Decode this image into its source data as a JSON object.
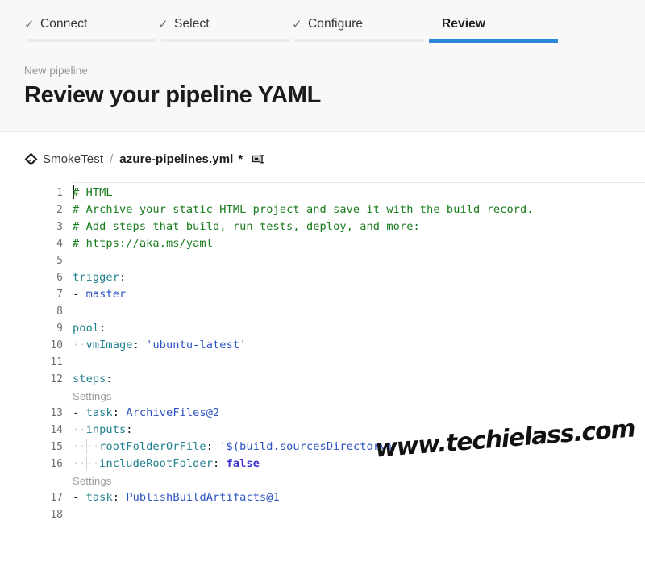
{
  "wizard": {
    "tabs": [
      {
        "label": "Connect",
        "check": "✓",
        "state": "complete"
      },
      {
        "label": "Select",
        "check": "✓",
        "state": "complete"
      },
      {
        "label": "Configure",
        "check": "✓",
        "state": "complete"
      },
      {
        "label": "Review",
        "check": "",
        "state": "active"
      }
    ],
    "active_accent": "#2b88d8",
    "rail_color": "#ebebeb"
  },
  "header": {
    "eyebrow": "New pipeline",
    "title": "Review your pipeline YAML"
  },
  "file_bar": {
    "repo_icon": "azure-repos-git-icon",
    "repo": "SmokeTest",
    "separator": "/",
    "file": "azure-pipelines.yml",
    "dirty_marker": "*",
    "rename_icon": "rename-icon"
  },
  "editor": {
    "language": "yaml",
    "codelens_label": "Settings",
    "lines": [
      {
        "num": "1",
        "type": "code",
        "indent": 0,
        "segments": [
          {
            "t": "# HTML",
            "c": "tok-comment"
          }
        ]
      },
      {
        "num": "2",
        "type": "code",
        "indent": 0,
        "segments": [
          {
            "t": "# Archive your static HTML project and save it with the build record.",
            "c": "tok-comment"
          }
        ]
      },
      {
        "num": "3",
        "type": "code",
        "indent": 0,
        "segments": [
          {
            "t": "# Add steps that build, run tests, deploy, and more:",
            "c": "tok-comment"
          }
        ]
      },
      {
        "num": "4",
        "type": "code",
        "indent": 0,
        "segments": [
          {
            "t": "# ",
            "c": "tok-comment"
          },
          {
            "t": "https://aka.ms/yaml",
            "c": "tok-link"
          }
        ]
      },
      {
        "num": "5",
        "type": "code",
        "indent": 0,
        "segments": []
      },
      {
        "num": "6",
        "type": "code",
        "indent": 0,
        "segments": [
          {
            "t": "trigger",
            "c": "tok-key"
          },
          {
            "t": ":",
            "c": "tok-punct"
          }
        ]
      },
      {
        "num": "7",
        "type": "code",
        "indent": 0,
        "segments": [
          {
            "t": "-",
            "c": "tok-dash"
          },
          {
            "t": " ",
            "c": "ws"
          },
          {
            "t": "master",
            "c": "tok-val"
          }
        ]
      },
      {
        "num": "8",
        "type": "code",
        "indent": 0,
        "segments": []
      },
      {
        "num": "9",
        "type": "code",
        "indent": 0,
        "segments": [
          {
            "t": "pool",
            "c": "tok-key"
          },
          {
            "t": ":",
            "c": "tok-punct"
          }
        ]
      },
      {
        "num": "10",
        "type": "code",
        "indent": 1,
        "segments": [
          {
            "t": "vmImage",
            "c": "tok-key"
          },
          {
            "t": ":",
            "c": "tok-punct"
          },
          {
            "t": " ",
            "c": "ws"
          },
          {
            "t": "'ubuntu-latest'",
            "c": "tok-string"
          }
        ]
      },
      {
        "num": "11",
        "type": "code",
        "indent": 0,
        "segments": []
      },
      {
        "num": "12",
        "type": "code",
        "indent": 0,
        "segments": [
          {
            "t": "steps",
            "c": "tok-key"
          },
          {
            "t": ":",
            "c": "tok-punct"
          }
        ]
      },
      {
        "num": "",
        "type": "codelens",
        "indent": 0,
        "segments": [
          {
            "t": "Settings",
            "c": ""
          }
        ]
      },
      {
        "num": "13",
        "type": "code",
        "indent": 0,
        "segments": [
          {
            "t": "-",
            "c": "tok-dash"
          },
          {
            "t": " ",
            "c": "ws"
          },
          {
            "t": "task",
            "c": "tok-key"
          },
          {
            "t": ":",
            "c": "tok-punct"
          },
          {
            "t": " ",
            "c": "ws"
          },
          {
            "t": "ArchiveFiles@2",
            "c": "tok-val"
          }
        ]
      },
      {
        "num": "14",
        "type": "code",
        "indent": 1,
        "segments": [
          {
            "t": "inputs",
            "c": "tok-key"
          },
          {
            "t": ":",
            "c": "tok-punct"
          }
        ]
      },
      {
        "num": "15",
        "type": "code",
        "indent": 2,
        "segments": [
          {
            "t": "rootFolderOrFile",
            "c": "tok-key"
          },
          {
            "t": ":",
            "c": "tok-punct"
          },
          {
            "t": " ",
            "c": "ws"
          },
          {
            "t": "'$(build.sourcesDirectory)'",
            "c": "tok-string"
          }
        ]
      },
      {
        "num": "16",
        "type": "code",
        "indent": 2,
        "segments": [
          {
            "t": "includeRootFolder",
            "c": "tok-key"
          },
          {
            "t": ":",
            "c": "tok-punct"
          },
          {
            "t": " ",
            "c": "ws"
          },
          {
            "t": "false",
            "c": "tok-bool"
          }
        ]
      },
      {
        "num": "",
        "type": "codelens",
        "indent": 0,
        "segments": [
          {
            "t": "Settings",
            "c": ""
          }
        ]
      },
      {
        "num": "17",
        "type": "code",
        "indent": 0,
        "segments": [
          {
            "t": "-",
            "c": "tok-dash"
          },
          {
            "t": " ",
            "c": "ws"
          },
          {
            "t": "task",
            "c": "tok-key"
          },
          {
            "t": ":",
            "c": "tok-punct"
          },
          {
            "t": " ",
            "c": "ws"
          },
          {
            "t": "PublishBuildArtifacts@1",
            "c": "tok-val"
          }
        ]
      },
      {
        "num": "18",
        "type": "code",
        "indent": 0,
        "segments": []
      }
    ]
  },
  "watermark": {
    "text": "www.techielass.com"
  }
}
